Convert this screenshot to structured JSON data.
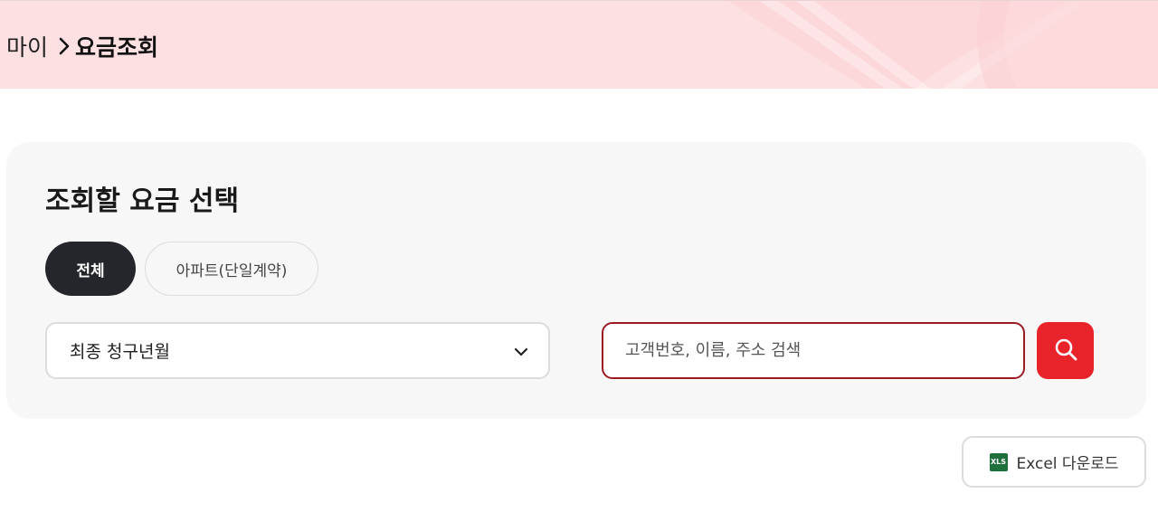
{
  "header": {
    "breadcrumb_root": "마이",
    "breadcrumb_current": "요금조회",
    "bg_color": "#fde0e1"
  },
  "panel": {
    "title": "조회할 요금 선택",
    "chips": [
      {
        "label": "전체",
        "selected": true
      },
      {
        "label": "아파트(단일계약)",
        "selected": false
      }
    ],
    "select": {
      "value": "최종 청구년월"
    },
    "search": {
      "placeholder": "고객번호, 이름, 주소 검색",
      "value": ""
    }
  },
  "actions": {
    "excel_label": "Excel 다운로드",
    "excel_icon_text": "XLS"
  },
  "colors": {
    "accent": "#e8232a",
    "search_border": "#9c1b22",
    "chip_selected": "#24262b"
  }
}
